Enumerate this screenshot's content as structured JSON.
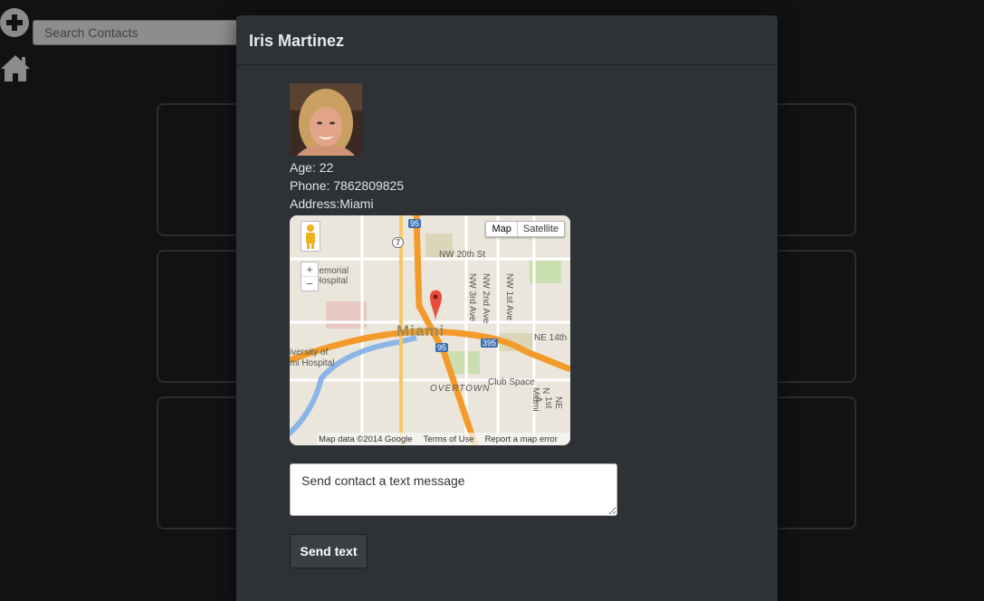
{
  "search": {
    "placeholder": "Search Contacts"
  },
  "icons": {
    "add": "plus-circle-icon",
    "home": "home-icon"
  },
  "modal": {
    "title": "Iris Martinez",
    "age_line": "Age: 22",
    "phone_line": "Phone: 7862809825",
    "address_line": "Address:Miami"
  },
  "map": {
    "type_map": "Map",
    "type_satellite": "Satellite",
    "zoom_in": "+",
    "zoom_out": "−",
    "footer_data": "Map data ©2014 Google",
    "footer_terms": "Terms of Use",
    "footer_report": "Report a map error",
    "labels": {
      "nw20th": "NW 20th St",
      "miami": "Miami",
      "overtown": "OVERTOWN",
      "clubspace": "Club Space",
      "ne14th": "NE 14th",
      "memorial": "Memorial",
      "hospital": "Hospital",
      "university": "iversity of",
      "mihospital": "mi Hospital",
      "nw2nd": "NW 2nd Ave",
      "nw3rd": "NW 3rd Ave",
      "nw1st": "NW 1st Ave",
      "nmiami": "N Miami",
      "ne1st": "NE 1st A",
      "i95": "95",
      "i395": "395",
      "r7": "7"
    }
  },
  "message": {
    "placeholder": "Send contact a text message"
  },
  "send": {
    "label": "Send text"
  },
  "colors": {
    "background": "#1b1c1f",
    "modal": "#2e3236",
    "card_border": "#444648",
    "button": "#3b3f43"
  }
}
